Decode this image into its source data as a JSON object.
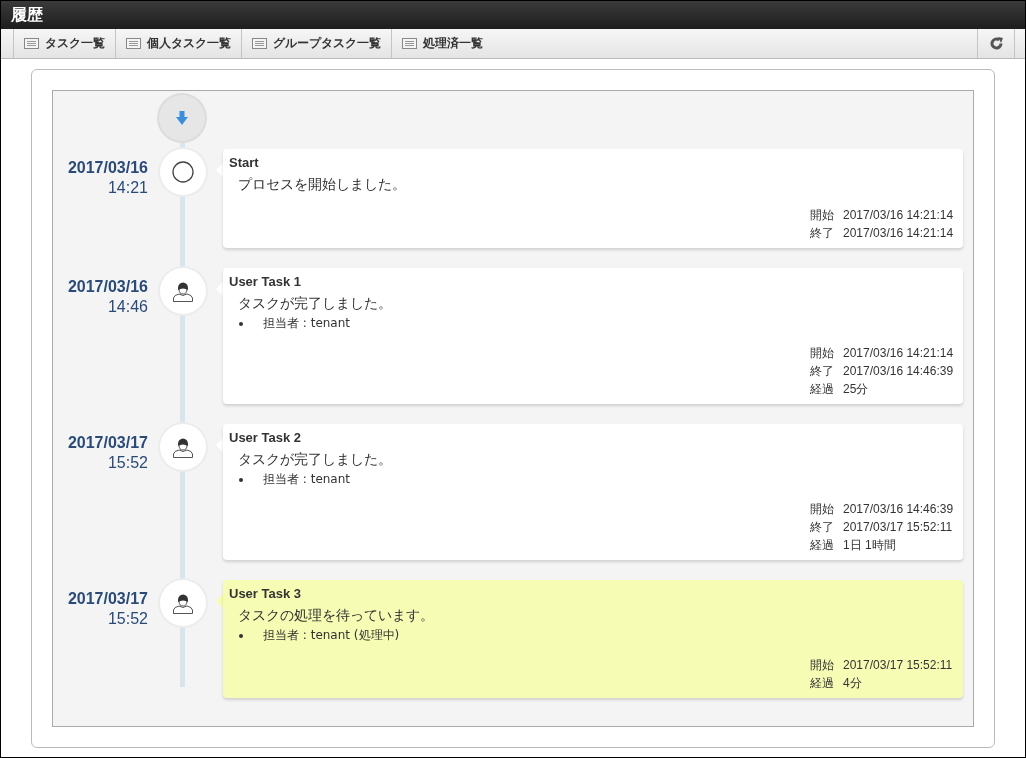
{
  "window": {
    "title": "履歴"
  },
  "toolbar": {
    "tabs": [
      {
        "label": "タスク一覧"
      },
      {
        "label": "個人タスク一覧"
      },
      {
        "label": "グループタスク一覧"
      },
      {
        "label": "処理済一覧"
      }
    ]
  },
  "timeline": {
    "events": [
      {
        "kind": "start",
        "date": "2017/03/16",
        "time": "14:21",
        "title": "Start",
        "message": "プロセスを開始しました。",
        "active": false,
        "details": [
          {
            "label": "開始",
            "value": "2017/03/16 14:21:14"
          },
          {
            "label": "終了",
            "value": "2017/03/16 14:21:14"
          }
        ]
      },
      {
        "kind": "task",
        "date": "2017/03/16",
        "time": "14:46",
        "title": "User Task 1",
        "message": "タスクが完了しました。",
        "active": false,
        "bullets": [
          "担当者 : tenant"
        ],
        "details": [
          {
            "label": "開始",
            "value": "2017/03/16 14:21:14"
          },
          {
            "label": "終了",
            "value": "2017/03/16 14:46:39"
          },
          {
            "label": "経過",
            "value": "25分"
          }
        ]
      },
      {
        "kind": "task",
        "date": "2017/03/17",
        "time": "15:52",
        "title": "User Task 2",
        "message": "タスクが完了しました。",
        "active": false,
        "bullets": [
          "担当者 : tenant"
        ],
        "details": [
          {
            "label": "開始",
            "value": "2017/03/16 14:46:39"
          },
          {
            "label": "終了",
            "value": "2017/03/17 15:52:11"
          },
          {
            "label": "経過",
            "value": "1日 1時間"
          }
        ]
      },
      {
        "kind": "task",
        "date": "2017/03/17",
        "time": "15:52",
        "title": "User Task 3",
        "message": "タスクの処理を待っています。",
        "active": true,
        "bullets": [
          "担当者 : tenant (処理中)"
        ],
        "details": [
          {
            "label": "開始",
            "value": "2017/03/17 15:52:11"
          },
          {
            "label": "経過",
            "value": "4分"
          }
        ]
      }
    ]
  }
}
